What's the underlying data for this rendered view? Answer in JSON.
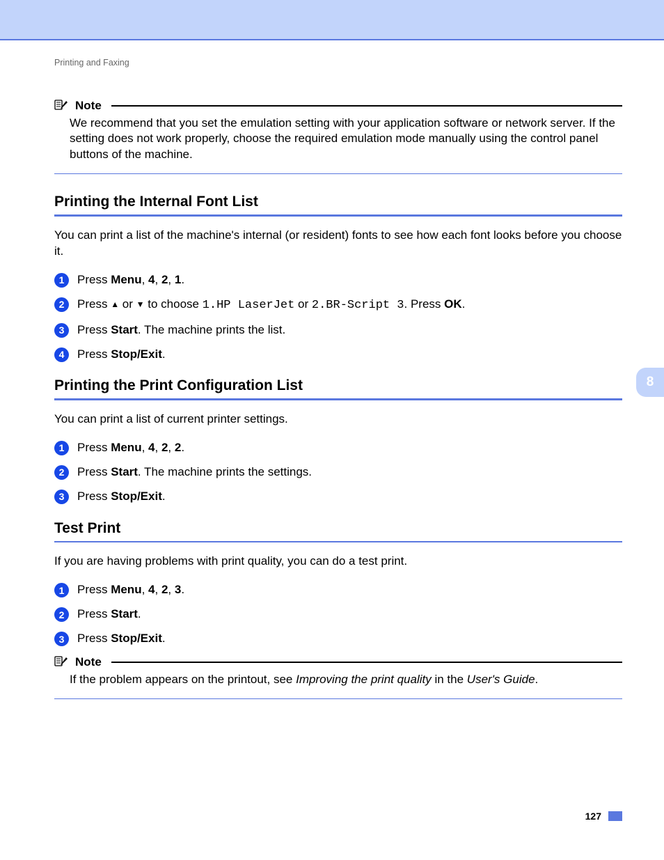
{
  "running_head": "Printing and Faxing",
  "side_tab": "8",
  "page_number": "127",
  "note_label": "Note",
  "note1": {
    "body": "We recommend that you set the emulation setting with your application software or network server. If the setting does not work properly, choose the required emulation mode manually using the control panel buttons of the machine."
  },
  "sec1": {
    "title": "Printing the Internal Font List",
    "intro": "You can print a list of the machine's internal (or resident) fonts to see how each font looks before you choose it.",
    "steps": {
      "s1": {
        "press": "Press ",
        "menu": "Menu",
        "comma1": ", ",
        "k1": "4",
        "comma2": ", ",
        "k2": "2",
        "comma3": ", ",
        "k3": "1",
        "period": "."
      },
      "s2": {
        "t1": "Press ",
        "up": "▲",
        "t2": " or ",
        "down": "▼",
        "t3": " to choose ",
        "opt1": "1.HP LaserJet",
        "t4": " or ",
        "opt2": "2.BR-Script 3",
        "t5": ". Press ",
        "ok": "OK",
        "t6": "."
      },
      "s3": {
        "t1": "Press ",
        "start": "Start",
        "t2": ". The machine prints the list."
      },
      "s4": {
        "t1": "Press ",
        "stop": "Stop/Exit",
        "t2": "."
      }
    }
  },
  "sec2": {
    "title": "Printing the Print Configuration List",
    "intro": "You can print a list of current printer settings.",
    "steps": {
      "s1": {
        "press": "Press ",
        "menu": "Menu",
        "comma1": ", ",
        "k1": "4",
        "comma2": ", ",
        "k2": "2",
        "comma3": ", ",
        "k3": "2",
        "period": "."
      },
      "s2": {
        "t1": "Press ",
        "start": "Start",
        "t2": ". The machine prints the settings."
      },
      "s3": {
        "t1": "Press ",
        "stop": "Stop/Exit",
        "t2": "."
      }
    }
  },
  "sec3": {
    "title": "Test Print",
    "intro": "If you are having problems with print quality, you can do a test print.",
    "steps": {
      "s1": {
        "press": "Press ",
        "menu": "Menu",
        "comma1": ", ",
        "k1": "4",
        "comma2": ", ",
        "k2": "2",
        "comma3": ", ",
        "k3": "3",
        "period": "."
      },
      "s2": {
        "t1": "Press ",
        "start": "Start",
        "t2": "."
      },
      "s3": {
        "t1": "Press ",
        "stop": "Stop/Exit",
        "t2": "."
      }
    }
  },
  "note2": {
    "t1": "If the problem appears on the printout, see ",
    "italic1": "Improving the print quality",
    "t2": " in the ",
    "italic2": "User's Guide",
    "t3": "."
  }
}
